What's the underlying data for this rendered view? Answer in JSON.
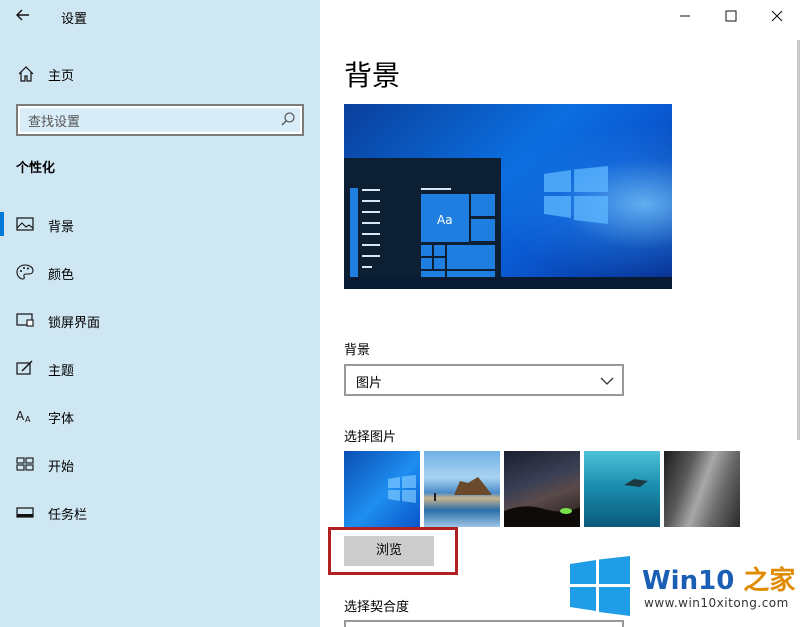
{
  "window": {
    "title": "设置",
    "controls": {
      "minimize": "minimize-icon",
      "maximize": "maximize-icon",
      "close": "close-icon"
    }
  },
  "sidebar": {
    "home_label": "主页",
    "search_placeholder": "查找设置",
    "section_title": "个性化",
    "items": [
      {
        "label": "背景",
        "icon": "picture-icon",
        "active": true
      },
      {
        "label": "颜色",
        "icon": "palette-icon",
        "active": false
      },
      {
        "label": "锁屏界面",
        "icon": "lockscreen-icon",
        "active": false
      },
      {
        "label": "主题",
        "icon": "theme-icon",
        "active": false
      },
      {
        "label": "字体",
        "icon": "font-icon",
        "active": false
      },
      {
        "label": "开始",
        "icon": "start-icon",
        "active": false
      },
      {
        "label": "任务栏",
        "icon": "taskbar-icon",
        "active": false
      }
    ]
  },
  "main": {
    "title": "背景",
    "preview_sample_text": "Aa",
    "background_label": "背景",
    "background_value": "图片",
    "choose_picture_label": "选择图片",
    "browse_label": "浏览",
    "fit_label": "选择契合度"
  },
  "watermark": {
    "brand_prefix": "Win10 ",
    "brand_suffix": "之家",
    "url": "www.win10xitong.com"
  },
  "colors": {
    "sidebar_bg": "#cfe6f3",
    "accent": "#0078d7",
    "highlight_border": "#b02020"
  }
}
